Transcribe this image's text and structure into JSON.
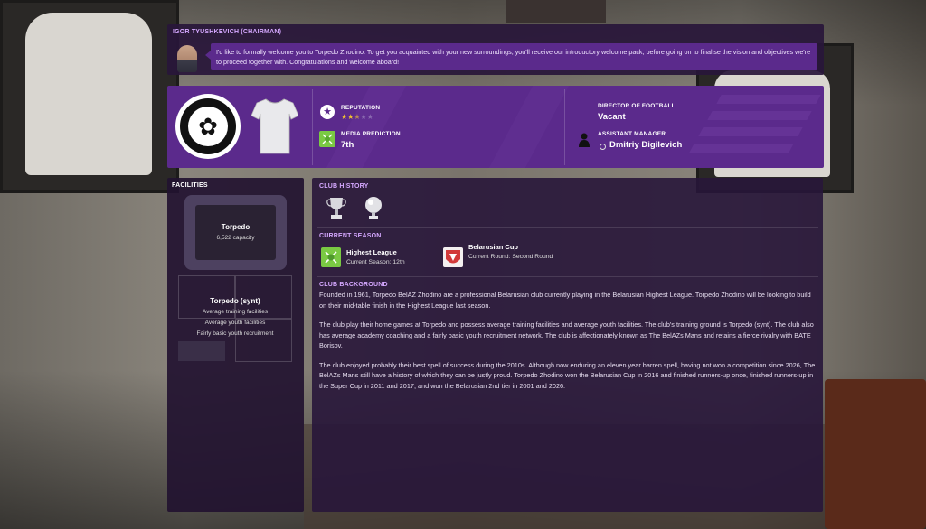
{
  "chairman": {
    "name": "IGOR TYUSHKEVICH (CHAIRMAN)",
    "message": "I'd like to formally welcome you to Torpedo Zhodino. To get you acquainted with your new surroundings, you'll receive our introductory welcome pack, before going on to finalise the vision and objectives we're to proceed together with. Congratulations and welcome aboard!"
  },
  "club": {
    "reputation_label": "REPUTATION",
    "reputation_stars": 2.5,
    "reputation_max": 5,
    "media_label": "MEDIA PREDICTION",
    "media_value": "7th",
    "dof_label": "DIRECTOR OF FOOTBALL",
    "dof_value": "Vacant",
    "asst_label": "ASSISTANT MANAGER",
    "asst_value": "Dmitriy Digilevich"
  },
  "facilities": {
    "title": "FACILITIES",
    "stadium_name": "Torpedo",
    "stadium_capacity": "6,522 capacity",
    "training_name": "Torpedo (synt)",
    "training_line1": "Average training facilities",
    "training_line2": "Average youth facilities",
    "training_line3": "Fairly basic youth recruitment"
  },
  "history": {
    "title": "CLUB HISTORY"
  },
  "season": {
    "title": "CURRENT SEASON",
    "comp1_name": "Highest League",
    "comp1_stage": "Current Season: 12th",
    "comp2_name": "Belarusian Cup",
    "comp2_stage": "Current Round: Second Round",
    "colors": {
      "league": "#7ac943",
      "cup": "#d23a3a"
    }
  },
  "background": {
    "title": "CLUB BACKGROUND",
    "p1": "Founded in 1961, Torpedo BelAZ Zhodino are a professional Belarusian club currently playing in the Belarusian Highest League. Torpedo Zhodino will be looking to build on their mid-table finish in the Highest League last season.",
    "p2": "The club play their home games at Torpedo and possess average training facilities and average youth facilities. The club's training ground is Torpedo (synt). The club also has average academy coaching and a fairly basic youth recruitment network. The club is affectionately known as The BelAZs Mans and retains a fierce rivalry with BATE Borisov.",
    "p3": "The club enjoyed probably their best spell of success during the 2010s. Although now enduring an eleven year barren spell, having not won a competition since 2026, The BelAZs Mans still have a history of which they can be justly proud. Torpedo Zhodino won the Belarusian Cup in 2016 and finished runners-up once, finished runners-up in the Super Cup in 2011 and 2017, and won the Belarusian 2nd tier in 2001 and 2026."
  },
  "theme": {
    "accent": "#5b2a8c",
    "accent_light": "#d5a8ff",
    "star": "#f2c230"
  }
}
